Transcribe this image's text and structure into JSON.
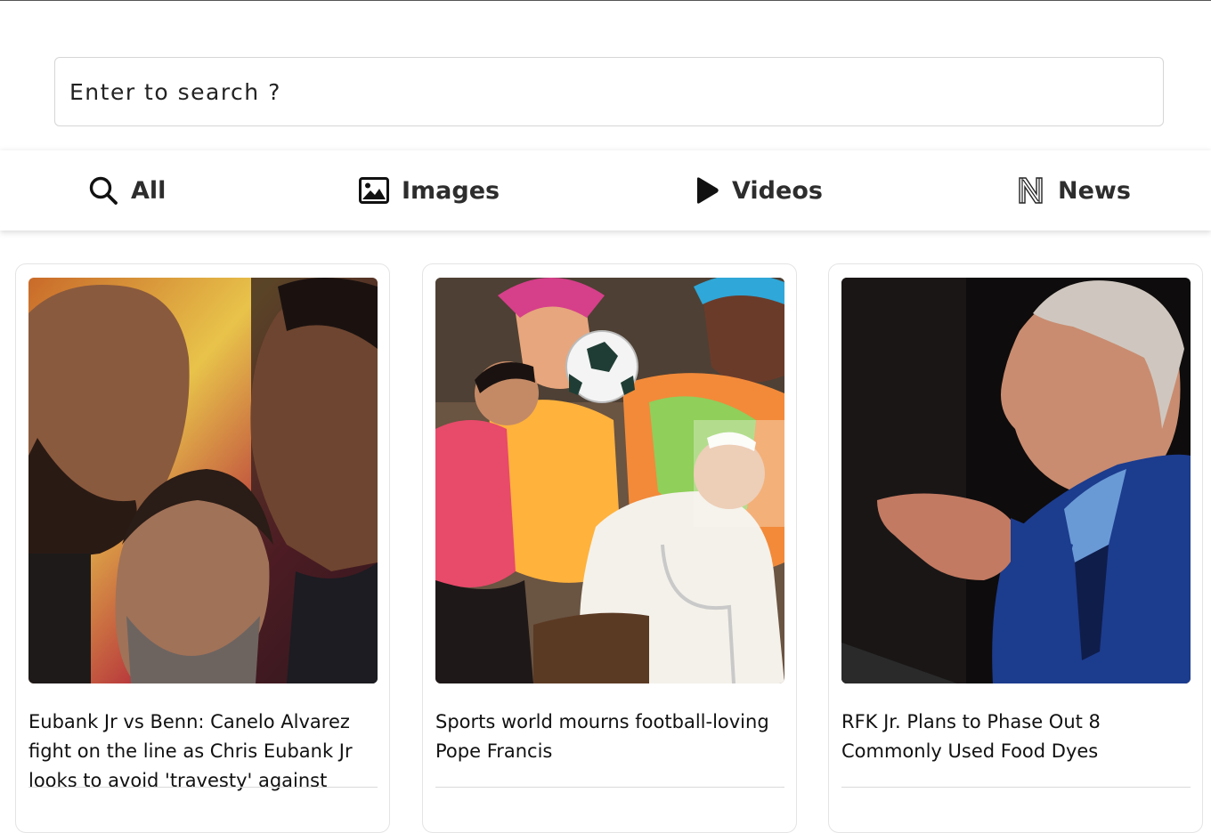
{
  "search": {
    "placeholder": "Enter to search ?"
  },
  "tabs": [
    {
      "label": "All",
      "icon": "search-icon"
    },
    {
      "label": "Images",
      "icon": "image-icon"
    },
    {
      "label": "Videos",
      "icon": "play-icon"
    },
    {
      "label": "News",
      "icon": "news-logo-icon"
    }
  ],
  "articles": [
    {
      "headline": "Eubank Jr vs Benn: Canelo Alvarez fight on the line as Chris Eubank Jr looks to avoid 'travesty' against"
    },
    {
      "headline": "Sports world mourns football-loving Pope Francis"
    },
    {
      "headline": "RFK Jr. Plans to Phase Out 8 Commonly Used Food Dyes"
    }
  ]
}
